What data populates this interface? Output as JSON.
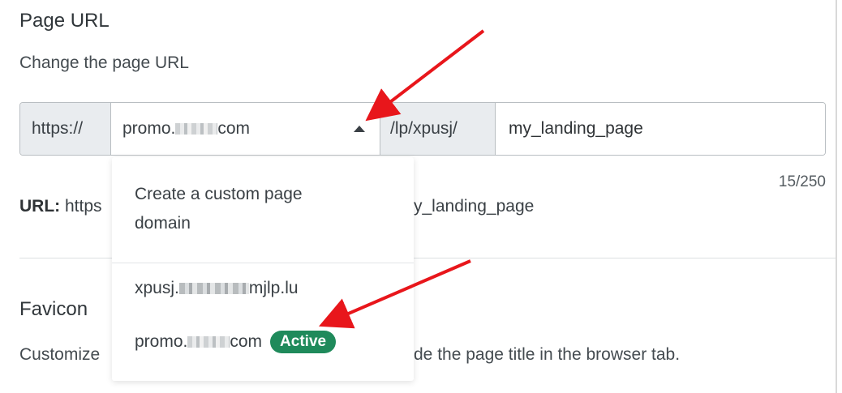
{
  "page_url": {
    "title": "Page URL",
    "description": "Change the page URL",
    "scheme": "https://",
    "domain_prefix": "promo.",
    "domain_suffix": "com",
    "path_prefix": "/lp/xpusj/",
    "slug_value": "my_landing_page",
    "char_counter": "15/250",
    "url_label": "URL:",
    "url_start": "https",
    "url_end": "y_landing_page"
  },
  "dropdown": {
    "create_custom": "Create a custom page",
    "create_custom_line2": "domain",
    "option1_prefix": "xpusj.",
    "option1_suffix": "mjlp.lu",
    "option2_prefix": "promo.",
    "option2_suffix": "com",
    "active_badge": "Active"
  },
  "favicon": {
    "title": "Favicon",
    "description_start": "Customize",
    "description_end": "de the page title in the browser tab."
  },
  "colors": {
    "arrow": "#e8161b",
    "badge": "#1f8a5b"
  }
}
